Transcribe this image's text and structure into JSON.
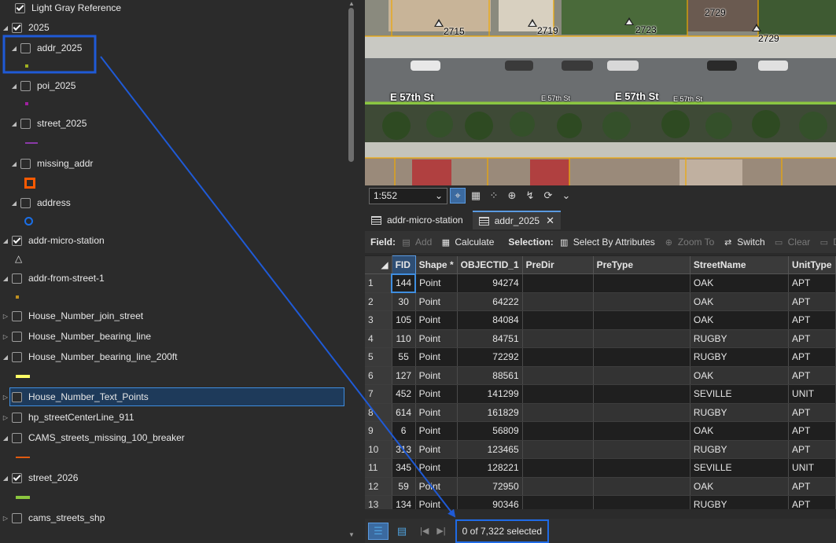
{
  "contents": {
    "layers": [
      {
        "label": "Light Gray Reference",
        "checked": true,
        "expander": "none"
      },
      {
        "label": "2025",
        "checked": true,
        "expander": "expanded"
      },
      {
        "label": "addr_2025",
        "checked": false,
        "expander": "expanded"
      },
      {
        "label": "poi_2025",
        "checked": false,
        "expander": "expanded"
      },
      {
        "label": "street_2025",
        "checked": false,
        "expander": "expanded"
      },
      {
        "label": "missing_addr",
        "checked": false,
        "expander": "expanded"
      },
      {
        "label": "address",
        "checked": false,
        "expander": "expanded"
      },
      {
        "label": "addr-micro-station",
        "checked": true,
        "expander": "expanded"
      },
      {
        "label": "addr-from-street-1",
        "checked": false,
        "expander": "expanded"
      },
      {
        "label": "House_Number_join_street",
        "checked": false,
        "expander": "collapsed"
      },
      {
        "label": "House_Number_bearing_line",
        "checked": false,
        "expander": "collapsed"
      },
      {
        "label": "House_Number_bearing_line_200ft",
        "checked": false,
        "expander": "expanded"
      },
      {
        "label": "House_Number_Text_Points",
        "checked": false,
        "expander": "collapsed",
        "selected": true
      },
      {
        "label": "hp_streetCenterLine_911",
        "checked": false,
        "expander": "collapsed"
      },
      {
        "label": "CAMS_streets_missing_100_breaker",
        "checked": false,
        "expander": "expanded"
      },
      {
        "label": "street_2026",
        "checked": true,
        "expander": "expanded"
      },
      {
        "label": "cams_streets_shp",
        "checked": false,
        "expander": "collapsed"
      }
    ],
    "symbol_colors": {
      "addr_2025": "#a0b020",
      "poi_2025": "#a020a0",
      "street_2025": "#8a3aa8",
      "missing_addr": "#ff5a00",
      "address": "#1a6fe8",
      "addr-from-street-1": "#c09020",
      "House_Number_bearing_line_200ft": "#ffff66",
      "CAMS_streets_missing_100_breaker": "#e05a10",
      "street_2026": "#8cc63f"
    }
  },
  "map": {
    "street_labels": [
      "E 57th St",
      "E 57th St",
      "E 57th St",
      "E 57th St"
    ],
    "address_numbers": [
      "2715",
      "2719",
      "2723",
      "2729",
      "2729"
    ]
  },
  "map_toolbar": {
    "scale": "1:552"
  },
  "table_tabs": [
    {
      "label": "addr-micro-station",
      "active": false
    },
    {
      "label": "addr_2025",
      "active": true
    }
  ],
  "table_toolbar": {
    "field_label": "Field:",
    "add_label": "Add",
    "calculate_label": "Calculate",
    "selection_label": "Selection:",
    "select_by_attributes_label": "Select By Attributes",
    "zoom_to_label": "Zoom To",
    "switch_label": "Switch",
    "clear_label": "Clear",
    "delete_label": "D"
  },
  "table": {
    "columns": [
      "FID",
      "Shape *",
      "OBJECTID_1",
      "PreDir",
      "PreType",
      "StreetName",
      "UnitType"
    ],
    "rows": [
      [
        "1",
        "144",
        "Point",
        "94274",
        "",
        "",
        "OAK",
        "APT"
      ],
      [
        "2",
        "30",
        "Point",
        "64222",
        "",
        "",
        "OAK",
        "APT"
      ],
      [
        "3",
        "105",
        "Point",
        "84084",
        "",
        "",
        "OAK",
        "APT"
      ],
      [
        "4",
        "110",
        "Point",
        "84751",
        "",
        "",
        "RUGBY",
        "APT"
      ],
      [
        "5",
        "55",
        "Point",
        "72292",
        "",
        "",
        "RUGBY",
        "APT"
      ],
      [
        "6",
        "127",
        "Point",
        "88561",
        "",
        "",
        "OAK",
        "APT"
      ],
      [
        "7",
        "452",
        "Point",
        "141299",
        "",
        "",
        "SEVILLE",
        "UNIT"
      ],
      [
        "8",
        "614",
        "Point",
        "161829",
        "",
        "",
        "RUGBY",
        "APT"
      ],
      [
        "9",
        "6",
        "Point",
        "56809",
        "",
        "",
        "OAK",
        "APT"
      ],
      [
        "10",
        "313",
        "Point",
        "123465",
        "",
        "",
        "RUGBY",
        "APT"
      ],
      [
        "11",
        "345",
        "Point",
        "128221",
        "",
        "",
        "SEVILLE",
        "UNIT"
      ],
      [
        "12",
        "59",
        "Point",
        "72950",
        "",
        "",
        "OAK",
        "APT"
      ],
      [
        "13",
        "134",
        "Point",
        "90346",
        "",
        "",
        "RUGBY",
        "APT"
      ]
    ]
  },
  "status": {
    "selection_text": "0 of 7,322 selected"
  },
  "annotation": {
    "color": "#1f5ad6"
  }
}
